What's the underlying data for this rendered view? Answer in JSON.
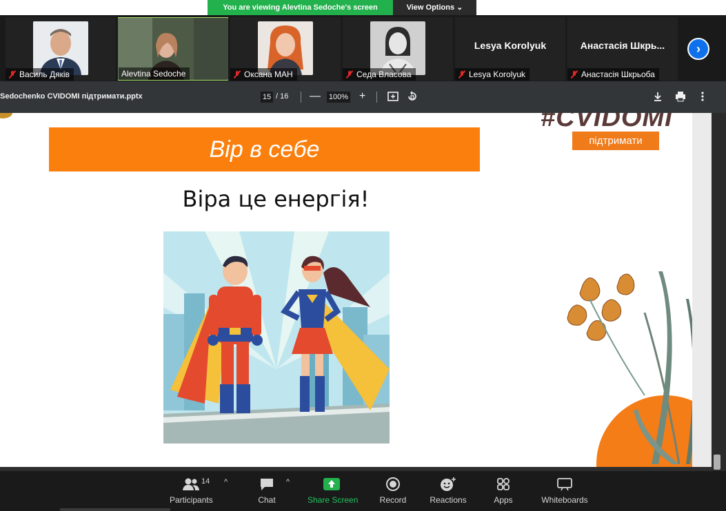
{
  "banner": {
    "viewing_text": "You are viewing Alevtina Sedoche's screen",
    "view_options": "View Options"
  },
  "participants": [
    {
      "name": "Василь Дяків",
      "muted": true,
      "has_photo": true
    },
    {
      "name": "Alevtina Sedoche",
      "muted": false,
      "has_photo": true,
      "active": true
    },
    {
      "name": "Оксана МАН",
      "muted": true,
      "has_photo": true
    },
    {
      "name": "Седа Власова",
      "muted": true,
      "has_photo": true
    },
    {
      "name": "Lesya Korolyuk",
      "muted": true,
      "has_photo": false,
      "display": "Lesya Korolyuk"
    },
    {
      "name": "Анастасія Шкрьоба",
      "muted": true,
      "has_photo": false,
      "display": "Анастасія Шкрь..."
    }
  ],
  "pdf_toolbar": {
    "file_name": "Sedochenko CVIDOMI підтримати.pptx",
    "current_page": "15",
    "page_separator": "/ 16",
    "zoom": "100%",
    "zoom_out": "—",
    "zoom_in": "+"
  },
  "slide": {
    "banner_text": "Вір в себе",
    "subtitle": "Віра це енергія!",
    "hashtag": "#CVIDOMI",
    "support_label": "підтримати"
  },
  "toolbar": {
    "participants_label": "Participants",
    "participants_count": "14",
    "chat_label": "Chat",
    "share_label": "Share Screen",
    "record_label": "Record",
    "reactions_label": "Reactions",
    "apps_label": "Apps",
    "whiteboards_label": "Whiteboards"
  },
  "colors": {
    "share_green": "#22b14c",
    "slide_orange": "#fb7f0c",
    "zoom_blue": "#0e71eb"
  }
}
